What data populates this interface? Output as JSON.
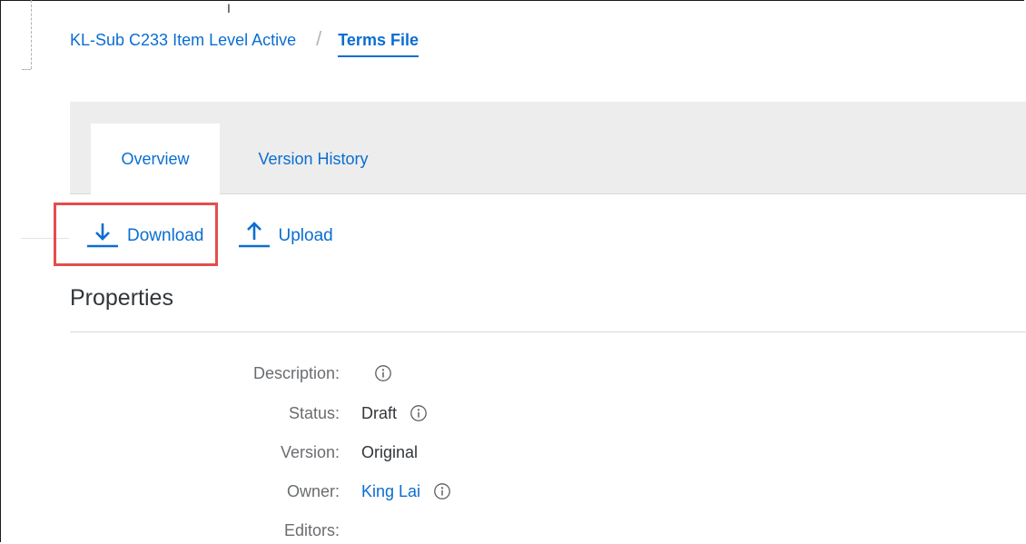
{
  "breadcrumb": {
    "parent": "KL-Sub C233 Item Level Active",
    "separator": "/",
    "current": "Terms File"
  },
  "tabs": [
    {
      "label": "Overview",
      "selected": true
    },
    {
      "label": "Version History",
      "selected": false
    }
  ],
  "actions": {
    "download_label": "Download",
    "upload_label": "Upload"
  },
  "section": {
    "title": "Properties"
  },
  "properties": {
    "description": {
      "label": "Description:",
      "value": ""
    },
    "status": {
      "label": "Status:",
      "value": "Draft"
    },
    "version": {
      "label": "Version:",
      "value": "Original"
    },
    "owner": {
      "label": "Owner:",
      "value": "King Lai"
    },
    "editors": {
      "label": "Editors:",
      "value": ""
    }
  },
  "icons": {
    "download": "download-arrow-icon",
    "upload": "upload-arrow-icon",
    "info": "info-circle-icon"
  },
  "colors": {
    "accent": "#0a6ed1",
    "highlight": "#e34d4d",
    "tab_bar": "#ededed"
  }
}
